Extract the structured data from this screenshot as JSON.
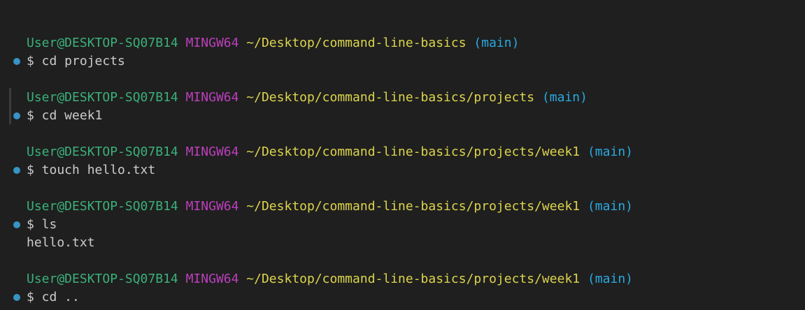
{
  "colors": {
    "background": "#1f1f1f",
    "user": "#3bb07a",
    "host": "#bc3fbc",
    "path": "#dcd44d",
    "branch": "#29a9e0",
    "text": "#cccccc",
    "decoration_dot": "#3794c4"
  },
  "blocks": [
    {
      "user": "User@DESKTOP-SQ07B14",
      "host": "MINGW64",
      "path": "~/Desktop/command-line-basics",
      "branch": "(main)",
      "command": "$ cd projects",
      "output": ""
    },
    {
      "user": "User@DESKTOP-SQ07B14",
      "host": "MINGW64",
      "path": "~/Desktop/command-line-basics/projects",
      "branch": "(main)",
      "command": "$ cd week1",
      "output": ""
    },
    {
      "user": "User@DESKTOP-SQ07B14",
      "host": "MINGW64",
      "path": "~/Desktop/command-line-basics/projects/week1",
      "branch": "(main)",
      "command": "$ touch hello.txt",
      "output": ""
    },
    {
      "user": "User@DESKTOP-SQ07B14",
      "host": "MINGW64",
      "path": "~/Desktop/command-line-basics/projects/week1",
      "branch": "(main)",
      "command": "$ ls",
      "output": "hello.txt"
    },
    {
      "user": "User@DESKTOP-SQ07B14",
      "host": "MINGW64",
      "path": "~/Desktop/command-line-basics/projects/week1",
      "branch": "(main)",
      "command": "$ cd ..",
      "output": ""
    }
  ]
}
